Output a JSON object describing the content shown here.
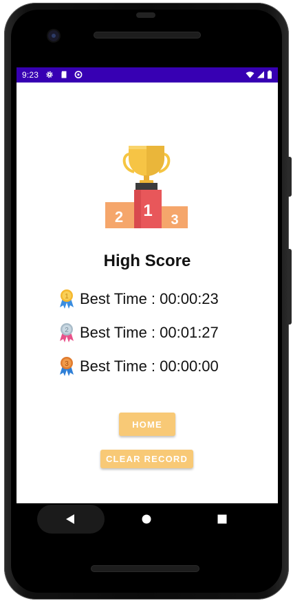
{
  "status_bar": {
    "time": "9:23",
    "icons_left": [
      "settings-icon",
      "sd-card-icon",
      "sync-icon"
    ],
    "icons_right": [
      "wifi-icon",
      "signal-icon",
      "battery-icon"
    ],
    "color": "#3700b3"
  },
  "page": {
    "title": "High Score",
    "records": [
      {
        "rank": "1",
        "medal": "gold-medal-icon",
        "label": "Best Time : 00:00:23"
      },
      {
        "rank": "2",
        "medal": "silver-medal-icon",
        "label": "Best Time : 00:01:27"
      },
      {
        "rank": "3",
        "medal": "bronze-medal-icon",
        "label": "Best Time : 00:00:00"
      }
    ],
    "podium": {
      "left": "2",
      "center": "1",
      "right": "3"
    }
  },
  "buttons": {
    "home_label": "HOME",
    "clear_label": "CLEAR RECORD",
    "color": "#f8c976"
  },
  "nav_bar": {
    "icons": [
      "back-icon",
      "home-circle-icon",
      "recents-icon"
    ]
  }
}
